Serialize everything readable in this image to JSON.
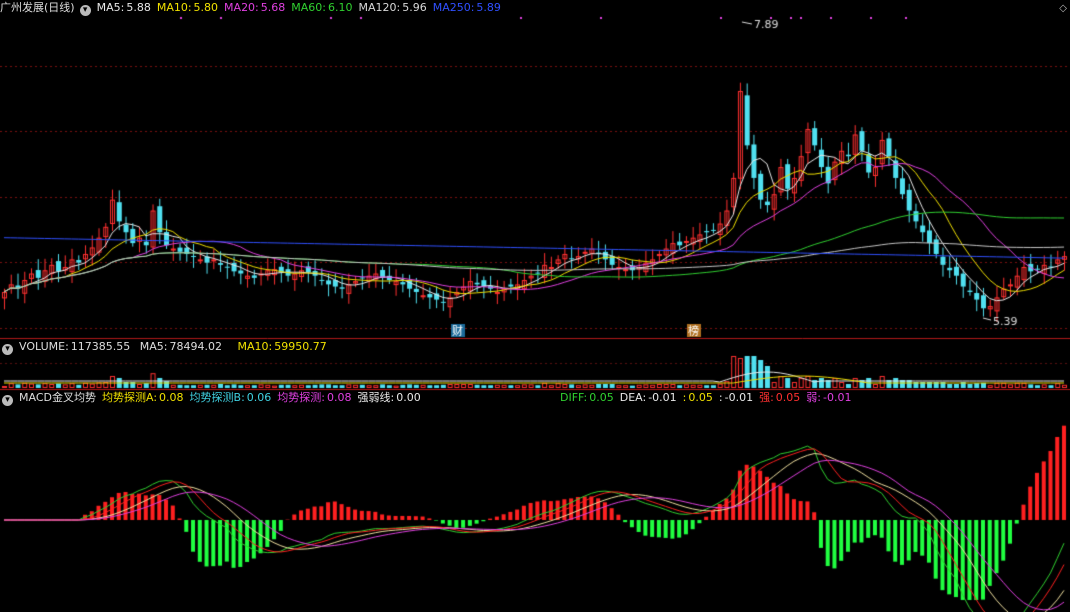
{
  "header": {
    "title": "广州发展(日线)",
    "ma": [
      {
        "label": "MA5:",
        "value": "5.88",
        "color": "#e8e8e8"
      },
      {
        "label": "MA10:",
        "value": "5.80",
        "color": "#f0e000"
      },
      {
        "label": "MA20:",
        "value": "5.68",
        "color": "#e040e0"
      },
      {
        "label": "MA60:",
        "value": "6.10",
        "color": "#30d030"
      },
      {
        "label": "MA120:",
        "value": "5.96",
        "color": "#d8d8d8"
      },
      {
        "label": "MA250:",
        "value": "5.89",
        "color": "#3050ff"
      }
    ]
  },
  "price_annotations": {
    "high": "7.89",
    "low": "5.39",
    "tag_cai": "财",
    "tag_bang": "榜"
  },
  "volume_panel": {
    "label": "VOLUME:",
    "value": "117385.55",
    "ma5_label": "MA5:",
    "ma5_value": "78494.02",
    "ma10_label": "MA10:",
    "ma10_value": "59950.77"
  },
  "macd_panel": {
    "name": "MACD金叉均势",
    "items": [
      {
        "label": "均势探测A:",
        "value": "0.08",
        "color": "#f0e000"
      },
      {
        "label": "均势探测B:",
        "value": "0.06",
        "color": "#40d0e0"
      },
      {
        "label": "均势探测:",
        "value": "0.08",
        "color": "#e040e0"
      },
      {
        "label": "强弱线:",
        "value": "0.00",
        "color": "#e8e8e8"
      }
    ],
    "right_items": [
      {
        "label": "DIFF:",
        "value": "0.05",
        "color": "#30d030"
      },
      {
        "label": "DEA:",
        "value": "-0.01",
        "color": "#e8e8e8"
      },
      {
        "label": ":",
        "value": "0.05",
        "color": "#f0e000"
      },
      {
        "label": ":",
        "value": "-0.01",
        "color": "#e8e8e8"
      },
      {
        "label": "强:",
        "value": "0.05",
        "color": "#ff3030"
      },
      {
        "label": "弱:",
        "value": "-0.01",
        "color": "#e040e0"
      }
    ]
  },
  "colors": {
    "up": "#ff3030",
    "down": "#50e0f0",
    "grid": "#7a1010",
    "separator": "#b01818"
  },
  "chart_data": {
    "type": "candlestick",
    "ylim": [
      5.2,
      8.1
    ],
    "closes": [
      5.55,
      5.62,
      5.58,
      5.66,
      5.72,
      5.68,
      5.75,
      5.8,
      5.74,
      5.78,
      5.85,
      5.82,
      5.9,
      5.96,
      6.05,
      6.15,
      6.4,
      6.2,
      6.1,
      6.0,
      6.05,
      5.98,
      6.3,
      6.1,
      5.98,
      5.95,
      5.92,
      5.9,
      5.88,
      5.85,
      5.82,
      5.85,
      5.8,
      5.78,
      5.74,
      5.72,
      5.7,
      5.68,
      5.72,
      5.75,
      5.76,
      5.73,
      5.7,
      5.72,
      5.75,
      5.73,
      5.7,
      5.66,
      5.62,
      5.6,
      5.58,
      5.62,
      5.65,
      5.68,
      5.7,
      5.72,
      5.68,
      5.66,
      5.65,
      5.62,
      5.58,
      5.55,
      5.52,
      5.5,
      5.48,
      5.45,
      5.5,
      5.55,
      5.6,
      5.65,
      5.62,
      5.6,
      5.58,
      5.55,
      5.58,
      5.6,
      5.62,
      5.66,
      5.7,
      5.72,
      5.8,
      5.78,
      5.85,
      5.9,
      5.86,
      5.88,
      5.92,
      5.95,
      5.9,
      5.85,
      5.8,
      5.78,
      5.76,
      5.75,
      5.78,
      5.82,
      5.85,
      5.9,
      5.95,
      6.0,
      5.98,
      6.02,
      6.05,
      6.08,
      6.1,
      6.12,
      6.18,
      6.3,
      6.6,
      7.4,
      6.9,
      6.6,
      6.4,
      6.35,
      6.45,
      6.7,
      6.5,
      6.6,
      6.8,
      7.05,
      6.9,
      6.7,
      6.55,
      6.75,
      6.85,
      6.8,
      7.0,
      6.85,
      6.65,
      6.7,
      6.95,
      6.8,
      6.6,
      6.45,
      6.3,
      6.2,
      6.1,
      6.0,
      5.9,
      5.8,
      5.75,
      5.7,
      5.6,
      5.55,
      5.48,
      5.4,
      5.42,
      5.5,
      5.58,
      5.62,
      5.7,
      5.78,
      5.74,
      5.76,
      5.8,
      5.78,
      5.85,
      5.88
    ],
    "high": "7.89",
    "low": "5.39"
  }
}
